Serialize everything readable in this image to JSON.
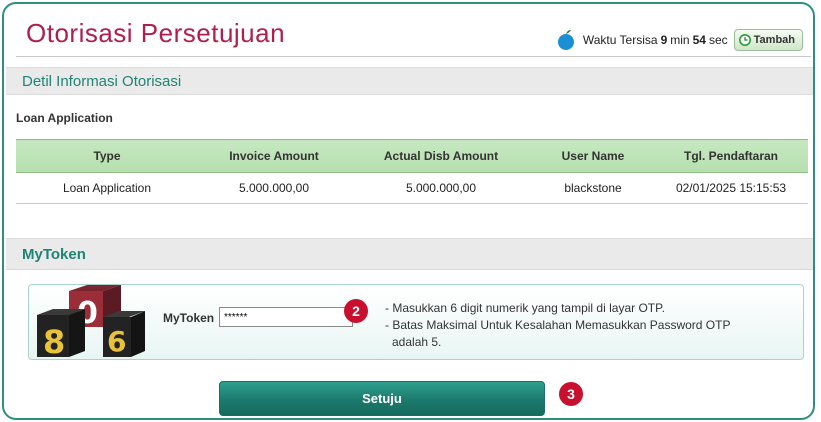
{
  "header": {
    "title": "Otorisasi Persetujuan",
    "timer_prefix": "Waktu Tersisa",
    "timer_minutes": "9",
    "timer_min_unit": "min",
    "timer_seconds": "54",
    "timer_sec_unit": "sec",
    "add_time_label": "Tambah"
  },
  "detail": {
    "section_title": "Detil Informasi Otorisasi",
    "sub_label": "Loan Application",
    "columns": [
      "Type",
      "Invoice Amount",
      "Actual Disb Amount",
      "User Name",
      "Tgl. Pendaftaran"
    ],
    "rows": [
      [
        "Loan Application",
        "5.000.000,00",
        "5.000.000,00",
        "blackstone",
        "02/01/2025 15:15:53"
      ]
    ]
  },
  "mytoken": {
    "section_title": "MyToken",
    "cube_digits": [
      "8",
      "0",
      "6"
    ],
    "field_label": "MyToken",
    "field_value": "******",
    "hints": [
      "- Masukkan 6 digit numerik yang tampil di layar OTP.",
      "- Batas Maksimal Untuk Kesalahan Memasukkan Password OTP",
      "adalah 5."
    ]
  },
  "actions": {
    "agree_label": "Setuju"
  },
  "callouts": {
    "step_2": "2",
    "step_3": "3"
  },
  "colors": {
    "title": "#b01e4b",
    "accent_teal": "#1f8474",
    "table_header": "#c6e8c1",
    "button": "#1b7a6c",
    "badge": "#c8102e"
  }
}
